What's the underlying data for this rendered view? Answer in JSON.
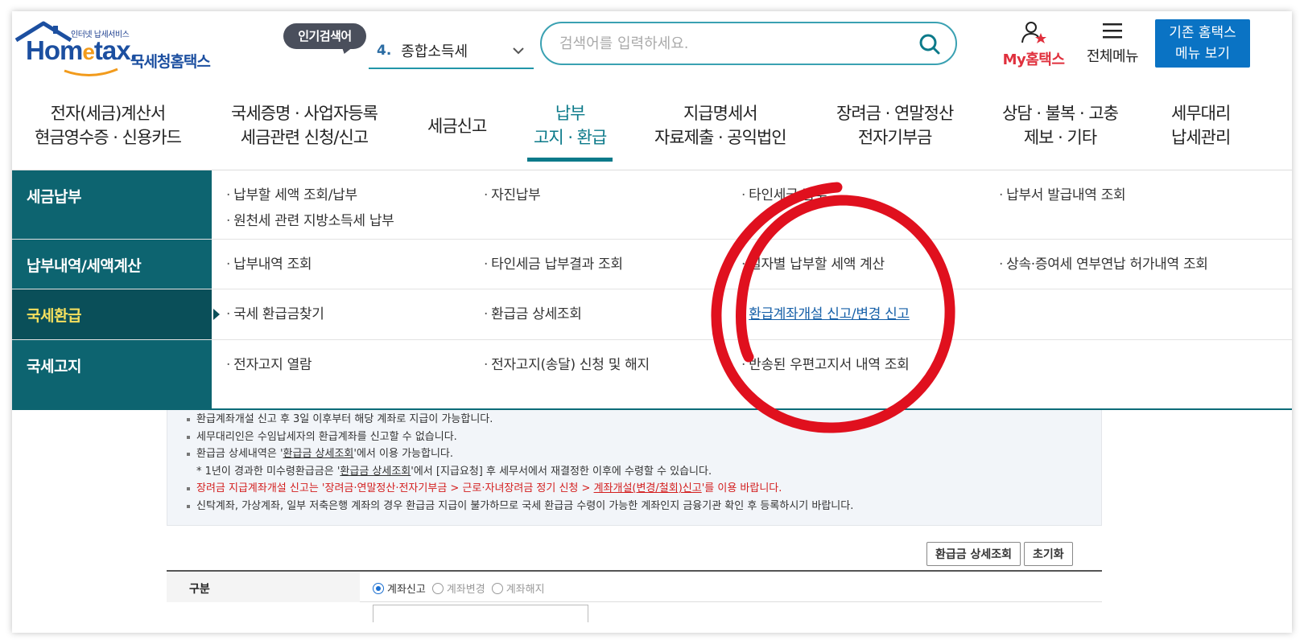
{
  "header": {
    "logo_small": "인터넷 납세서비스",
    "logo_brand_pre": "Hom",
    "logo_brand_e": "e",
    "logo_brand_post": "tax.",
    "logo_sub": "국세청홈택스",
    "popular_badge": "인기검색어",
    "popular_num": "4.",
    "popular_term": "종합소득세",
    "search_placeholder": "검색어를 입력하세요.",
    "my_home": "My홈택스",
    "all_menu": "전체메뉴",
    "old_home_line1": "기존 홈택스",
    "old_home_line2": "메뉴 보기"
  },
  "nav": [
    {
      "line1": "전자(세금)계산서",
      "line2": "현금영수증 · 신용카드"
    },
    {
      "line1": "국세증명 · 사업자등록",
      "line2": "세금관련 신청/신고"
    },
    {
      "line1": "세금신고",
      "line2": ""
    },
    {
      "line1": "납부",
      "line2": "고지 · 환급"
    },
    {
      "line1": "지급명세서",
      "line2": "자료제출 · 공익법인"
    },
    {
      "line1": "장려금 · 연말정산",
      "line2": "전자기부금"
    },
    {
      "line1": "상담 · 불복 · 고충",
      "line2": "제보 · 기타"
    },
    {
      "line1": "세무대리",
      "line2": "납세관리"
    }
  ],
  "mega": {
    "rows": [
      {
        "category": "세금납부",
        "links": [
          "납부할 세액 조회/납부",
          "자진납부",
          "타인세금 납부",
          "납부서 발급내역 조회",
          "원천세 관련 지방소득세 납부"
        ]
      },
      {
        "category": "납부내역/세액계산",
        "links": [
          "납부내역 조회",
          "타인세금 납부결과 조회",
          "일자별 납부할 세액 계산",
          "상속·증여세 연부연납 허가내역 조회"
        ]
      },
      {
        "category": "국세환급",
        "links": [
          "국세 환급금찾기",
          "환급금 상세조회",
          "환급계좌개설 신고/변경 신고"
        ]
      },
      {
        "category": "국세고지",
        "links": [
          "전자고지 열람",
          "전자고지(송달) 신청 및 해지",
          "반송된 우편고지서 내역 조회"
        ]
      }
    ]
  },
  "notice": {
    "line1": "환급계좌개설 신고 후 3일 이후부터 해당 계좌로 지급이 가능합니다.",
    "line2": "세무대리인은 수임납세자의 환급계좌를 신고할 수 없습니다.",
    "line3_pre": "환급금 상세내역은 '",
    "line3_link": "환급금 상세조회",
    "line3_post": "'에서 이용 가능합니다.",
    "line4_pre": "* 1년이 경과한 미수령환급금은 '",
    "line4_link": "환급금 상세조회",
    "line4_post": "'에서 [지급요청] 후 세무서에서 재결정한 이후에 수령할 수 있습니다.",
    "line5_pre": "장려금 지급계좌개설 신고는 '장려금·연말정산·전자기부금 > 근로·자녀장려금 정기 신청 > ",
    "line5_link": "계좌개설(변경/철회)신고",
    "line5_post": "'를 이용 바랍니다.",
    "line6": "신탁계좌, 가상계좌, 일부 저축은행 계좌의 경우 환급금 지급이 불가하므로 국세 환급금 수령이 가능한 계좌인지 금융기관 확인 후 등록하시기 바랍니다."
  },
  "buttons": {
    "detail": "환급금 상세조회",
    "reset": "초기화"
  },
  "form": {
    "label": "구분",
    "options": [
      "계좌신고",
      "계좌변경",
      "계좌해지"
    ]
  },
  "colors": {
    "brand": "#1c4fa0",
    "teal": "#0c7a8a",
    "side": "#0d6470",
    "side_active": "#0a4f59",
    "annotation": "#e0101e"
  }
}
